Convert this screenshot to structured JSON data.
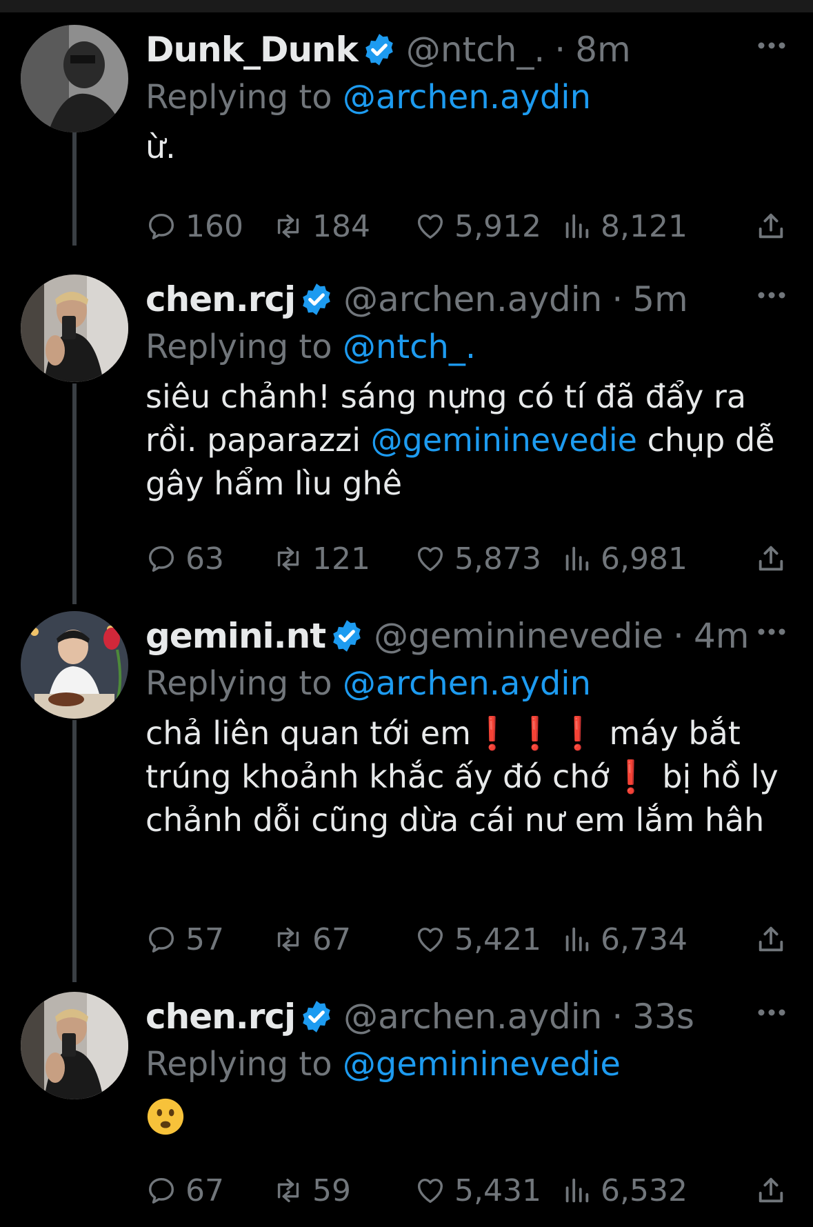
{
  "tweets": [
    {
      "name": "Dunk_Dunk",
      "handle": "@ntch_.",
      "dot": "·",
      "time": "8m",
      "replying_prefix": "Replying to ",
      "replying_to": "@archen.aydin",
      "text": "ừ.",
      "stats": {
        "replies": "160",
        "retweets": "184",
        "likes": "5,912",
        "views": "8,121"
      }
    },
    {
      "name": "chen.rcj",
      "handle": "@archen.aydin",
      "dot": "·",
      "time": "5m",
      "replying_prefix": "Replying to ",
      "replying_to": "@ntch_.",
      "text_part1": "siêu chảnh! sáng nựng có tí đã đẩy ra rồi. paparazzi ",
      "text_mention": "@gemininevedie",
      "text_part2": " chụp dễ gây hẩm lìu ghê",
      "stats": {
        "replies": "63",
        "retweets": "121",
        "likes": "5,873",
        "views": "6,981"
      }
    },
    {
      "name": "gemini.nt",
      "handle": "@gemininevedie",
      "dot": "·",
      "time": "4m",
      "replying_prefix": "Replying to ",
      "replying_to": "@archen.aydin",
      "text_part1": "chả liên quan tới em",
      "exclamation": "❗",
      "text_part2": " máy bắt trúng khoảnh khắc ấy đó chớ",
      "text_part3": " bị hồ ly chảnh dỗi cũng dừa cái nư em lắm hâh",
      "stats": {
        "replies": "57",
        "retweets": "67",
        "likes": "5,421",
        "views": "6,734"
      }
    },
    {
      "name": "chen.rcj",
      "handle": "@archen.aydin",
      "dot": "·",
      "time": "33s",
      "replying_prefix": "Replying to ",
      "replying_to": "@gemininevedie",
      "emoji": "frowning-face-emoji",
      "stats": {
        "replies": "67",
        "retweets": "59",
        "likes": "5,431",
        "views": "6,532"
      }
    }
  ],
  "colors": {
    "background": "#000000",
    "text": "#e7e9ea",
    "muted": "#71767b",
    "mention": "#1d9bf0",
    "verified": "#1d9bf0",
    "exclamation": "#e0242f"
  }
}
